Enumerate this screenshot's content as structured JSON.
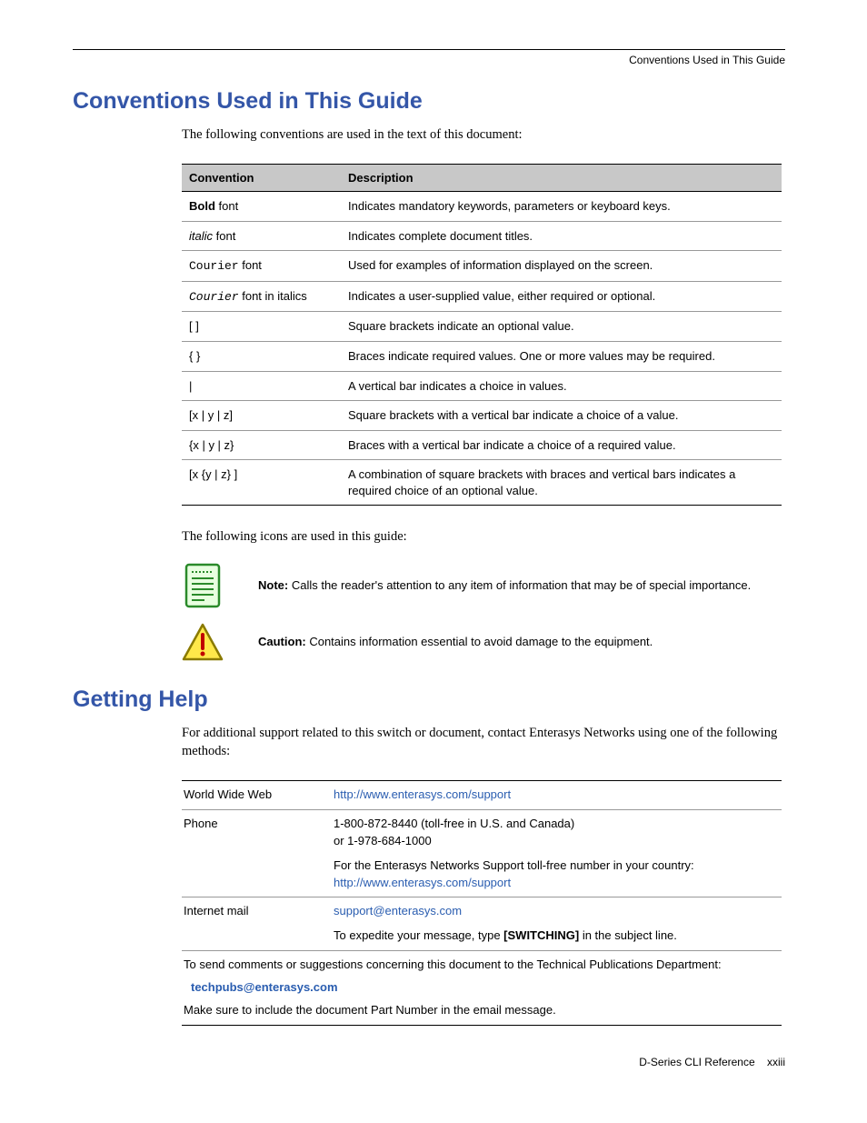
{
  "header": {
    "running": "Conventions Used in This Guide"
  },
  "sections": {
    "conventions": {
      "title": "Conventions Used in This Guide",
      "intro": "The following conventions are used in the text of this document:",
      "table": {
        "head": {
          "c1": "Convention",
          "c2": "Description"
        },
        "rows": [
          {
            "c1a": "Bold",
            "c1b": " font",
            "c2": "Indicates mandatory keywords, parameters or keyboard keys."
          },
          {
            "c1a": "italic",
            "c1b": " font",
            "c2": "Indicates complete document titles."
          },
          {
            "c1a": "Courier",
            "c1b": " font",
            "c2": "Used for examples of information displayed on the screen."
          },
          {
            "c1a": "Courier",
            "c1b": " font in italics",
            "c2": "Indicates a user-supplied value, either required or optional."
          },
          {
            "c1": "[ ]",
            "c2": "Square brackets indicate an optional value."
          },
          {
            "c1": "{ }",
            "c2": "Braces indicate required values. One or more values may be required."
          },
          {
            "c1": "|",
            "c2": "A vertical bar indicates a choice in values."
          },
          {
            "c1": "[x | y | z]",
            "c2": "Square brackets with a vertical bar indicate a choice of a value."
          },
          {
            "c1": "{x | y | z}",
            "c2": "Braces with a vertical bar indicate a choice of a required value."
          },
          {
            "c1": "[x {y | z} ]",
            "c2": "A combination of square brackets with braces and vertical bars indicates a required choice of an optional value."
          }
        ]
      },
      "icons_intro": "The following icons are used in this guide:",
      "note": {
        "label": "Note:",
        "text": " Calls the reader's attention to any item of information that may be of special importance."
      },
      "caution": {
        "label": "Caution:",
        "text": " Contains information essential to avoid damage to the equipment."
      }
    },
    "help": {
      "title": "Getting Help",
      "intro": "For additional support related to this switch or document, contact Enterasys Networks using one of the following methods:",
      "rows": {
        "www": {
          "label": "World Wide Web",
          "link": "http://www.enterasys.com/support"
        },
        "phone": {
          "label": "Phone",
          "line1": "1-800-872-8440 (toll-free in U.S. and Canada)",
          "line2": "or 1-978-684-1000",
          "line3": "For the Enterasys Networks Support toll-free number in your country:",
          "link": "http://www.enterasys.com/support"
        },
        "mail": {
          "label": "Internet mail",
          "link": "support@enterasys.com",
          "line2a": "To expedite your message, type ",
          "line2b": "[SWITCHING]",
          "line2c": " in the subject line."
        },
        "full": {
          "line1": "To send comments or suggestions concerning this document to the Technical Publications Department:",
          "link": "techpubs@enterasys.com",
          "line3": "Make sure to include the document Part Number in the email message."
        }
      }
    }
  },
  "footer": {
    "doc": "D-Series CLI Reference",
    "page": "xxiii"
  }
}
